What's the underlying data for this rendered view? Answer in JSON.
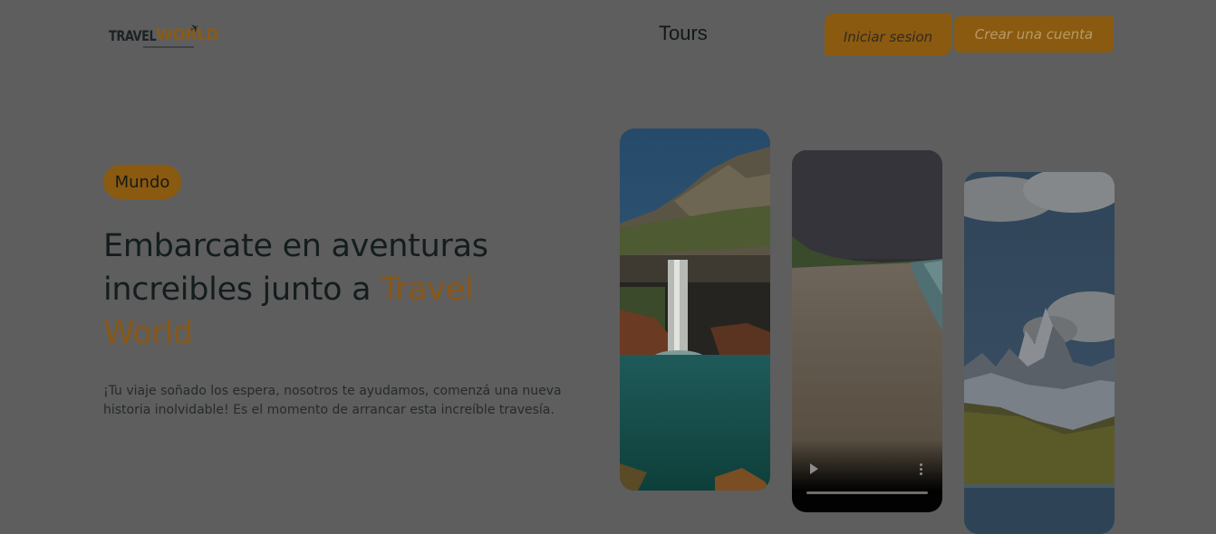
{
  "header": {
    "logo": {
      "travel": "TRAVEL",
      "world": "WORLD"
    },
    "nav": {
      "tours_label": "Tours"
    },
    "login_label": "Iniciar sesion",
    "signup_label": "Crear una cuenta"
  },
  "hero": {
    "badge": "Mundo",
    "title_main": "Embarcate en aventuras increibles junto a ",
    "title_accent": "Travel World",
    "description": "¡Tu viaje soñado los espera, nosotros te ayudamos, comenzá una nueva historia inolvidable! Es el momento de arrancar esta increíble travesía."
  },
  "gallery": {
    "cards": [
      {
        "kind": "image",
        "subject": "waterfall"
      },
      {
        "kind": "video",
        "subject": "beach"
      },
      {
        "kind": "image",
        "subject": "mountains"
      }
    ],
    "video_icons": [
      "play-icon",
      "more-vertical-icon"
    ]
  },
  "colors": {
    "accent": "#8a5a10",
    "overlay_background": "#5e5e5e",
    "text_dark": "#141d1e"
  }
}
